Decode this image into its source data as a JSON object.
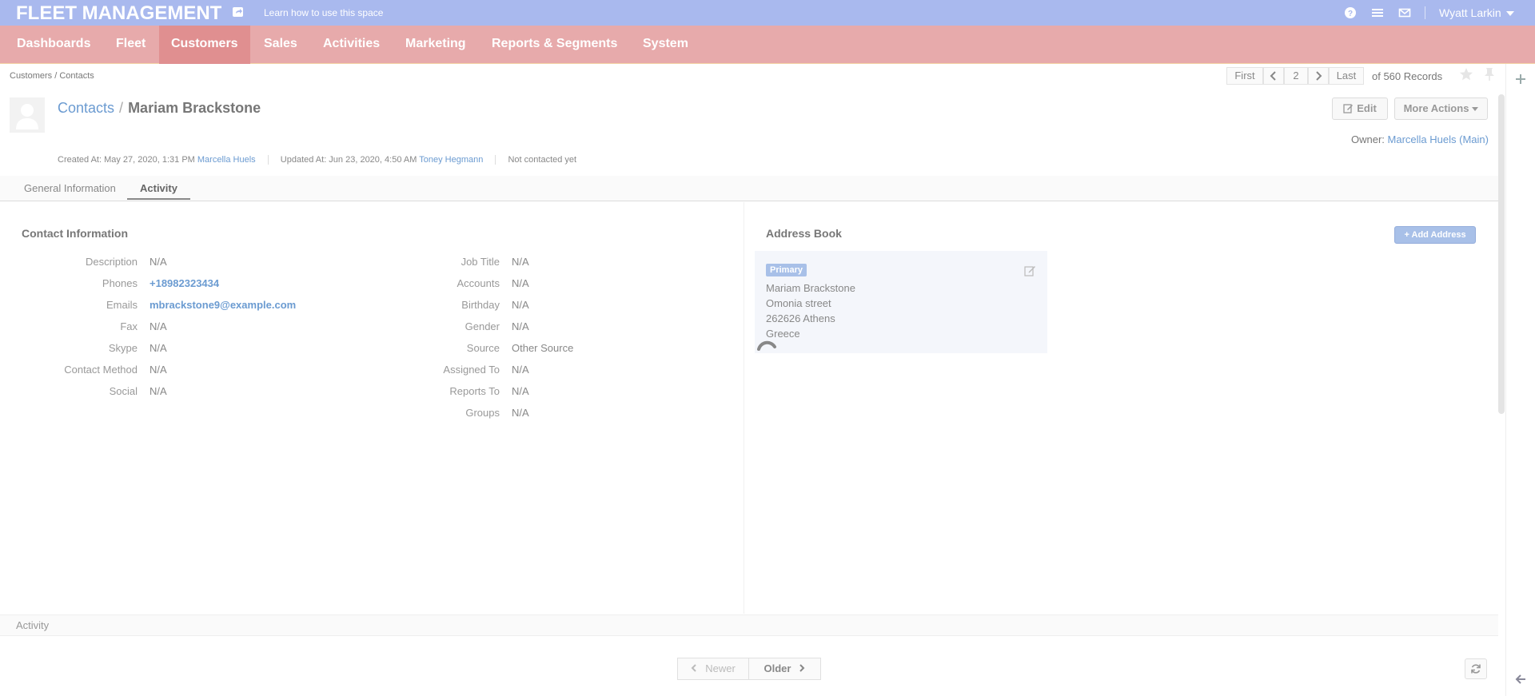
{
  "header": {
    "app_title": "FLEET MANAGEMENT",
    "learn_link": "Learn how to use this space",
    "user_name": "Wyatt Larkin",
    "icons": [
      "share-icon",
      "help-icon",
      "menu-icon",
      "mail-icon"
    ]
  },
  "nav": {
    "items": [
      {
        "label": "Dashboards"
      },
      {
        "label": "Fleet"
      },
      {
        "label": "Customers",
        "active": true
      },
      {
        "label": "Sales"
      },
      {
        "label": "Activities"
      },
      {
        "label": "Marketing"
      },
      {
        "label": "Reports & Segments"
      },
      {
        "label": "System"
      }
    ]
  },
  "breadcrumb": "Customers / Contacts",
  "pager": {
    "first": "First",
    "current": "2",
    "last": "Last",
    "records": "of 560 Records"
  },
  "title": {
    "crumb": "Contacts",
    "separator": "/",
    "name": "Mariam Brackstone"
  },
  "actions": {
    "edit": "Edit",
    "more": "More Actions"
  },
  "owner": {
    "label": "Owner:",
    "name": "Marcella Huels",
    "bu": "(Main)"
  },
  "meta": {
    "created": "Created At: May 27, 2020, 1:31 PM",
    "created_by": "Marcella Huels",
    "updated": "Updated At: Jun 23, 2020, 4:50 AM",
    "updated_by": "Toney Hegmann",
    "contacted": "Not contacted yet"
  },
  "tabs": [
    {
      "label": "General Information"
    },
    {
      "label": "Activity",
      "active": true
    }
  ],
  "contact_info": {
    "title": "Contact Information",
    "left": [
      {
        "label": "Description",
        "value": "N/A"
      },
      {
        "label": "Phones",
        "value": "+18982323434",
        "link": true
      },
      {
        "label": "Emails",
        "value": "mbrackstone9@example.com",
        "link": true
      },
      {
        "label": "Fax",
        "value": "N/A"
      },
      {
        "label": "Skype",
        "value": "N/A"
      },
      {
        "label": "Contact Method",
        "value": "N/A"
      },
      {
        "label": "Social",
        "value": "N/A"
      }
    ],
    "right": [
      {
        "label": "Job Title",
        "value": "N/A"
      },
      {
        "label": "Accounts",
        "value": "N/A"
      },
      {
        "label": "Birthday",
        "value": "N/A"
      },
      {
        "label": "Gender",
        "value": "N/A"
      },
      {
        "label": "Source",
        "value": "Other Source"
      },
      {
        "label": "Assigned To",
        "value": "N/A"
      },
      {
        "label": "Reports To",
        "value": "N/A"
      },
      {
        "label": "Groups",
        "value": "N/A"
      }
    ]
  },
  "address_book": {
    "title": "Address Book",
    "add_button": "+ Add Address",
    "badge": "Primary",
    "lines": [
      "Mariam Brackstone",
      "Omonia street",
      "262626 Athens",
      "Greece"
    ]
  },
  "activity": {
    "label": "Activity",
    "newer": "Newer",
    "older": "Older"
  },
  "colors": {
    "topbar": "#a9b9ee",
    "nav": "#e7aaab",
    "nav_active": "#e08f90",
    "link": "#6b9bd1"
  }
}
